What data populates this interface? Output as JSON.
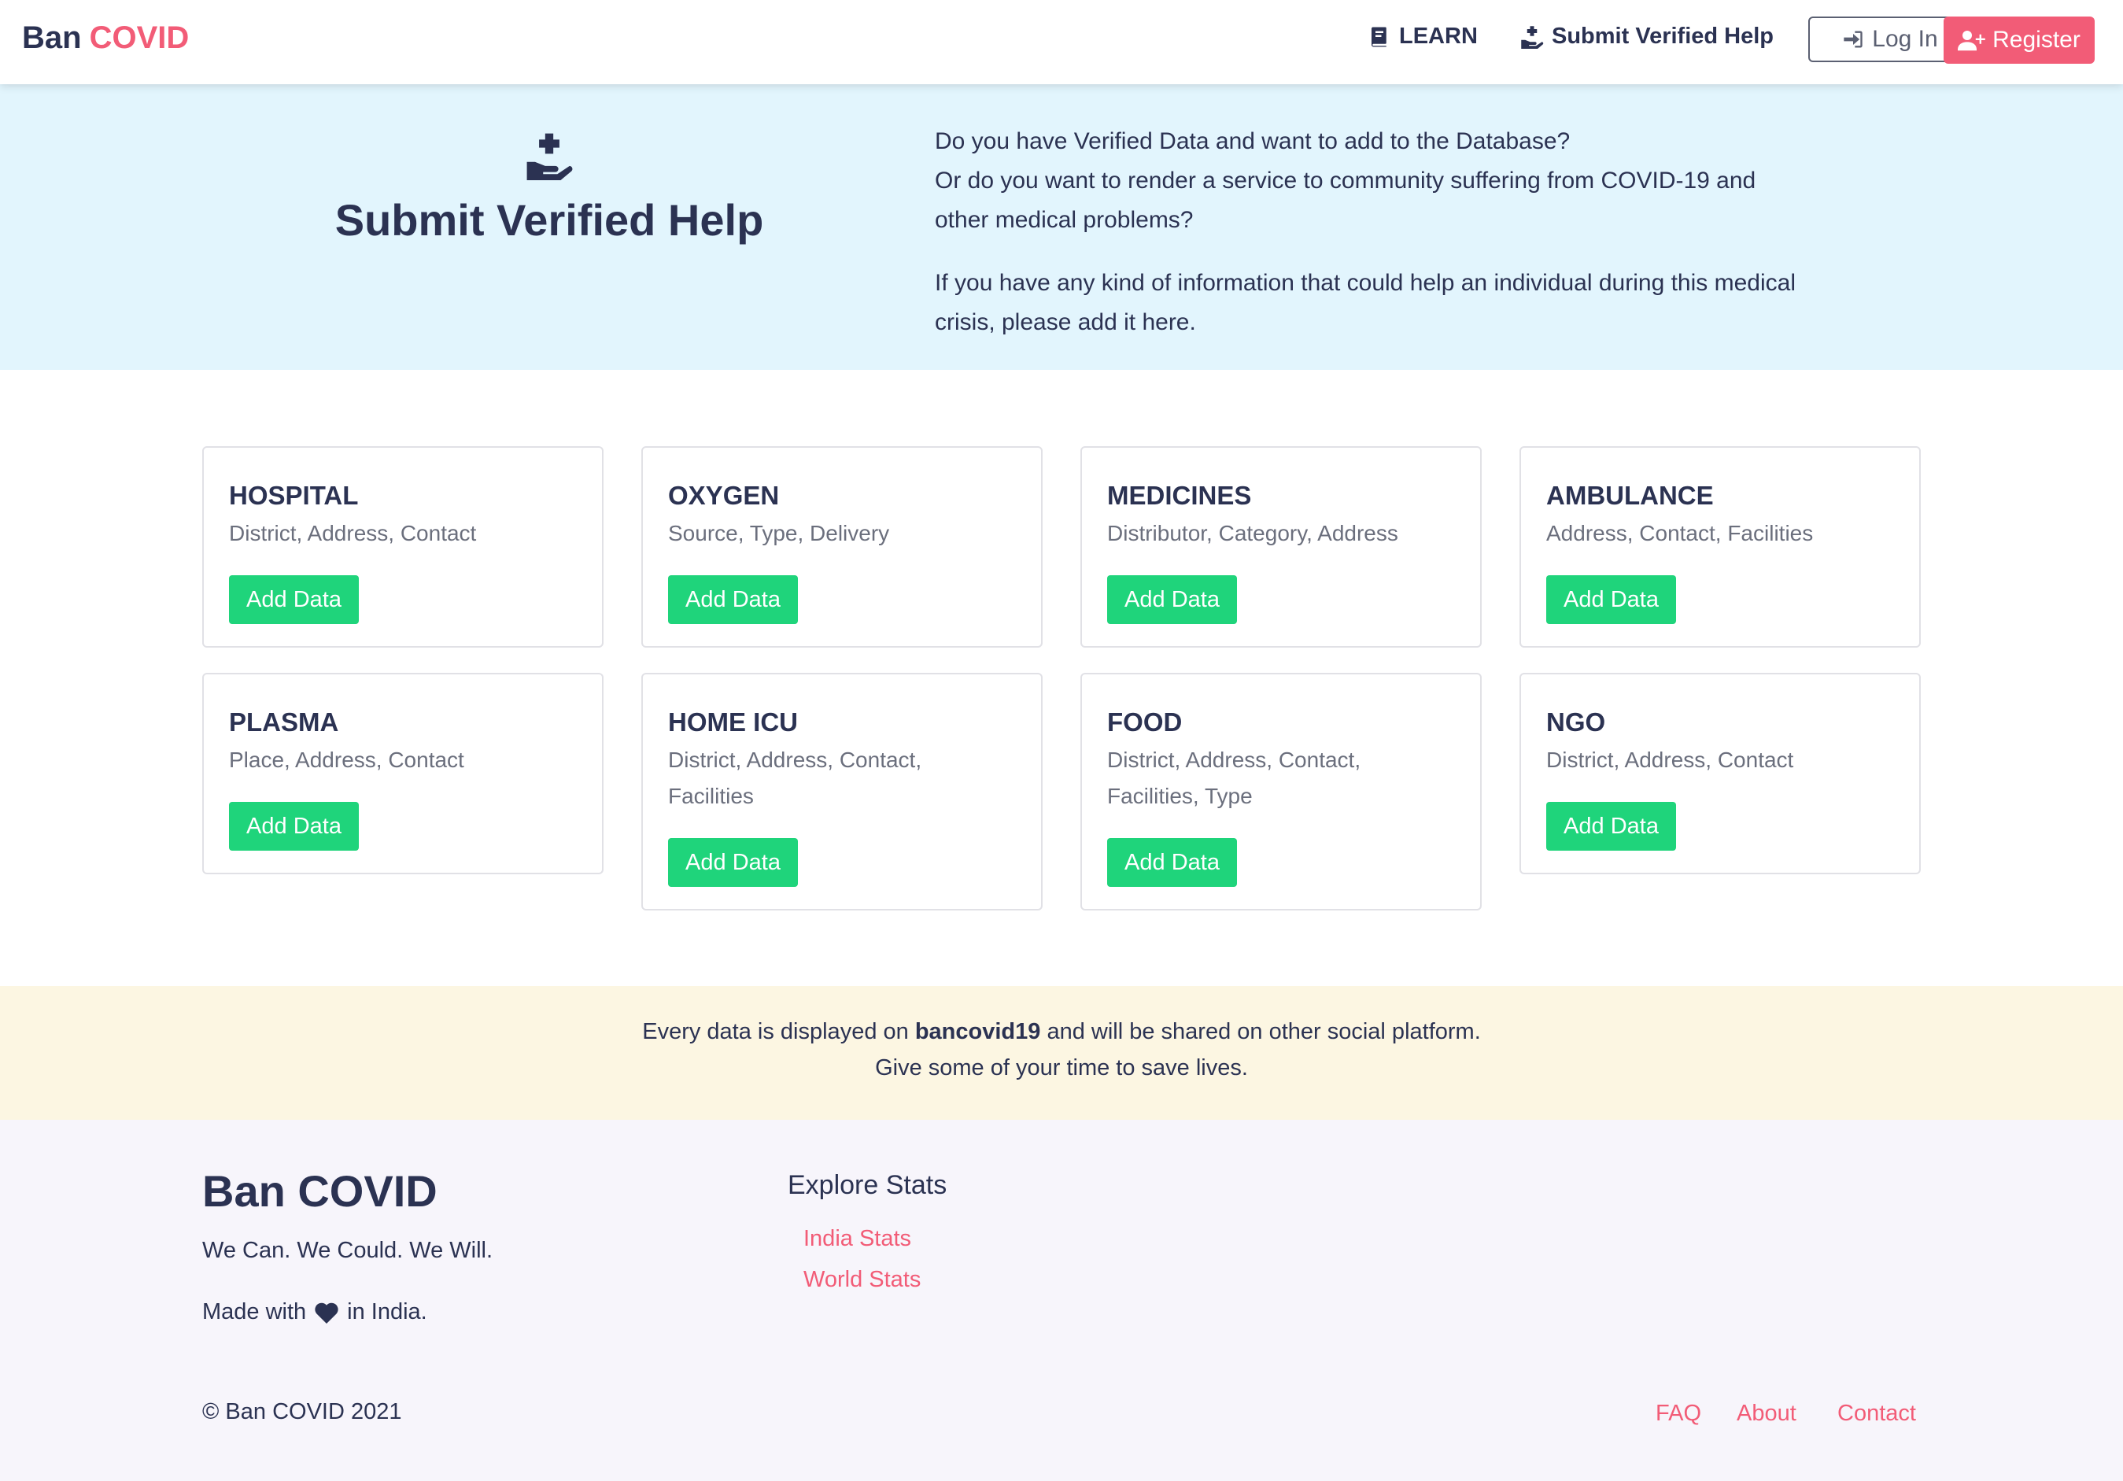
{
  "nav": {
    "brand_primary": "Ban",
    "brand_accent": "COVID",
    "learn_label": "LEARN",
    "submit_label": "Submit Verified Help",
    "login_label": "Log In",
    "register_label": "Register"
  },
  "hero": {
    "title": "Submit Verified Help",
    "para1_line1": "Do you have Verified Data and want to add to the Database?",
    "para1_line2": "Or do you want to render a service to community suffering from COVID-19 and other medical problems?",
    "para2": "If you have any kind of information that could help an individual during this medical crisis, please add it here."
  },
  "cards": [
    {
      "title": "HOSPITAL",
      "desc": "District, Address, Contact",
      "button": "Add Data"
    },
    {
      "title": "OXYGEN",
      "desc": "Source, Type, Delivery",
      "button": "Add Data"
    },
    {
      "title": "MEDICINES",
      "desc": "Distributor, Category, Address",
      "button": "Add Data"
    },
    {
      "title": "AMBULANCE",
      "desc": "Address, Contact, Facilities",
      "button": "Add Data"
    },
    {
      "title": "PLASMA",
      "desc": "Place, Address, Contact",
      "button": "Add Data"
    },
    {
      "title": "HOME ICU",
      "desc": "District, Address, Contact, Facilities",
      "button": "Add Data"
    },
    {
      "title": "FOOD",
      "desc": "District, Address, Contact, Facilities, Type",
      "button": "Add Data"
    },
    {
      "title": "NGO",
      "desc": "District, Address, Contact",
      "button": "Add Data"
    }
  ],
  "notice": {
    "line1_before": "Every data is displayed on",
    "line1_bold": "bancovid19",
    "line1_after": "and will be shared on other social platform.",
    "line2": "Give some of your time to save lives."
  },
  "footer": {
    "brand": "Ban COVID",
    "tagline": "We Can. We Could. We Will.",
    "made_before": "Made with",
    "made_after": "in India.",
    "explore_title": "Explore Stats",
    "stats_links": [
      "India Stats",
      "World Stats"
    ],
    "copyright": "© Ban COVID 2021",
    "links": [
      "FAQ",
      "About",
      "Contact"
    ]
  },
  "colors": {
    "navy": "#2b3252",
    "accent_pink": "#f25c77",
    "button_green": "#1fd47b",
    "hero_bg": "#e2f5fd",
    "notice_bg": "#fcf6e2",
    "footer_bg": "#f7f5fb"
  },
  "icons": {
    "learn": "book-icon",
    "submit": "hand-holding-medical-icon",
    "login": "sign-in-icon",
    "register": "user-plus-icon",
    "made_with": "heart-icon"
  }
}
